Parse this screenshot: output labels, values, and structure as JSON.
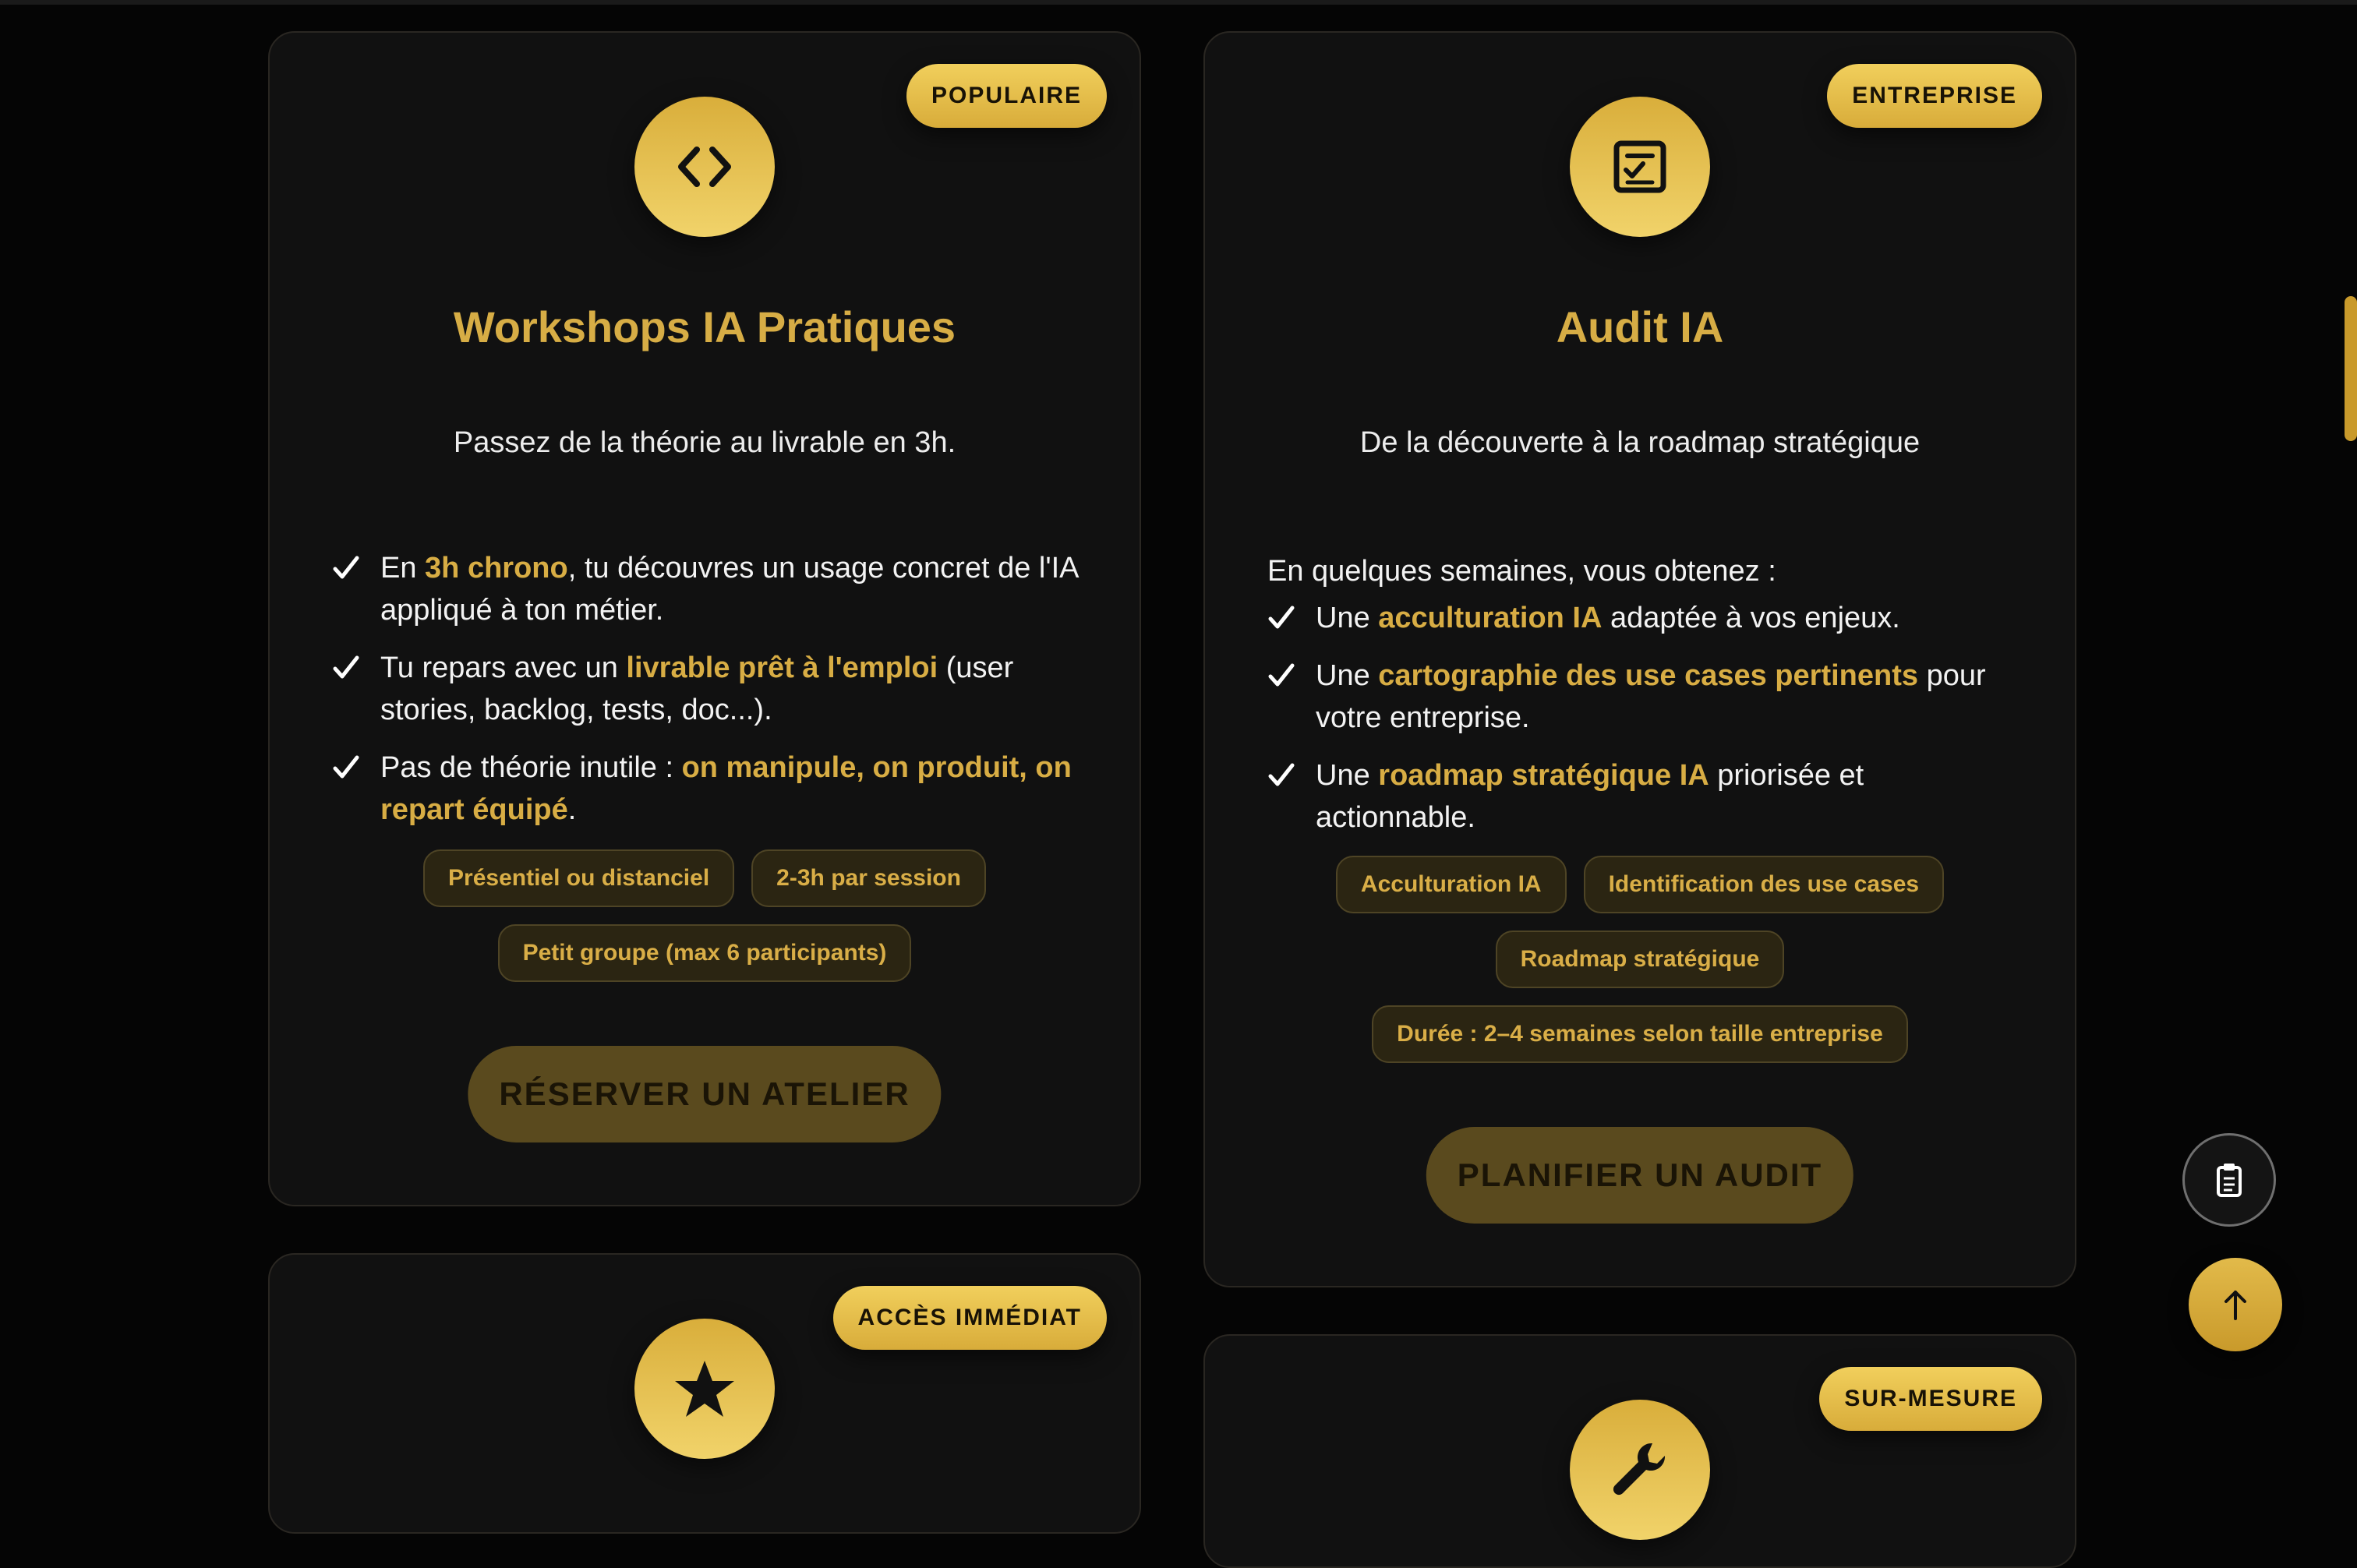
{
  "cards": {
    "workshops": {
      "badge": "POPULAIRE",
      "icon": "code-icon",
      "title": "Workshops IA Pratiques",
      "subtitle": "Passez de la théorie au livrable en 3h.",
      "features": [
        {
          "a": "En ",
          "b": "3h chrono",
          "c": ", tu découvres un usage concret de l'IA appliqué à ton métier."
        },
        {
          "a": "Tu repars avec un ",
          "b": "livrable prêt à l'emploi",
          "c": " (user stories, backlog, tests, doc...)."
        },
        {
          "a": "Pas de théorie inutile : ",
          "b": "on manipule, on produit, on repart équipé",
          "c": "."
        }
      ],
      "tags": [
        "Présentiel ou distanciel",
        "2-3h par session",
        "Petit groupe (max 6 participants)"
      ],
      "cta": "RÉSERVER UN ATELIER"
    },
    "audit": {
      "badge": "ENTREPRISE",
      "icon": "checklist-icon",
      "title": "Audit IA",
      "subtitle": "De la découverte à la roadmap stratégique",
      "intro": "En quelques semaines, vous obtenez :",
      "features": [
        {
          "a": "Une ",
          "b": "acculturation IA",
          "c": " adaptée à vos enjeux."
        },
        {
          "a": "Une ",
          "b": "cartographie des use cases pertinents",
          "c": " pour votre entreprise."
        },
        {
          "a": "Une ",
          "b": "roadmap stratégique IA",
          "c": " priorisée et actionnable."
        }
      ],
      "tags": [
        "Acculturation IA",
        "Identification des use cases",
        "Roadmap stratégique",
        "Durée : 2–4 semaines selon taille entreprise"
      ],
      "cta": "PLANIFIER UN AUDIT"
    },
    "immediate": {
      "badge": "ACCÈS IMMÉDIAT",
      "icon": "star-icon"
    },
    "custom": {
      "badge": "SUR-MESURE",
      "icon": "wrench-icon"
    }
  },
  "floating": {
    "doc_icon": "clipboard-icon",
    "top_icon": "arrow-up-icon"
  },
  "colors": {
    "accent": "#d8ad44",
    "badge": "#f1cf5c",
    "background": "#050505",
    "card": "#111111"
  }
}
